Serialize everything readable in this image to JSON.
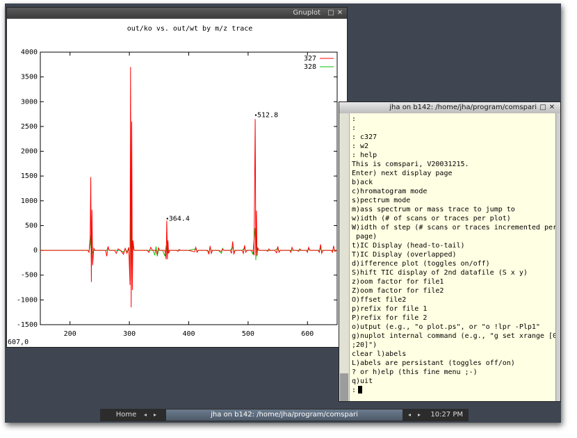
{
  "gnuplot_window": {
    "title": "Gnuplot",
    "status_text": "607,0"
  },
  "terminal_window": {
    "title": "jha on b142: /home/jha/program/comspari",
    "lines": [
      ":",
      ":",
      ": c327",
      ": w2",
      ": help",
      "This is comspari, V20031215.",
      "Enter) next display page",
      "b)ack",
      "c)hromatogram mode",
      "s)pectrum mode",
      "m)ass spectrum or mass trace to jump to",
      "w)idth (# of scans or traces per plot)",
      "W)idth of step (# scans or traces incremented per",
      " page)",
      "t)IC Display (head-to-tail)",
      "T)IC Display (overlapped)",
      "d)ifference plot (toggles on/off)",
      "S)hift TIC display of 2nd datafile (S x y)",
      "z)oom factor for file1",
      "Z)oom factor for file2",
      "O)ffset file2",
      "p)refix for file 1",
      "P)refix for file 2",
      "o)utput (e.g., \"o plot.ps\", or \"o !lpr -Plp1\"",
      "g)nuplot internal command (e.g., \"g set xrange [0",
      ";20]\")",
      "clear l)abels",
      "L)abels are persistant (toggles off/on)",
      "? or h)elp (this fine menu ;-)",
      "q)uit"
    ],
    "prompt": ":"
  },
  "taskbar": {
    "home_label": "Home",
    "task_label": "jha on b142: /home/jha/program/comspari",
    "clock": "10:27 PM"
  },
  "chart_data": {
    "type": "line",
    "title": "out/ko vs. out/wt by m/z trace",
    "xlim": [
      150,
      650
    ],
    "ylim": [
      -1500,
      4000
    ],
    "x_ticks": [
      "200",
      "300",
      "400",
      "500",
      "600"
    ],
    "y_ticks": [
      "-1500",
      "-1000",
      "-500",
      "0",
      "500",
      "1000",
      "1500",
      "2000",
      "2500",
      "3000",
      "3500",
      "4000"
    ],
    "legend_position": "top-right",
    "annotations": [
      {
        "text": "364.4",
        "x": 364,
        "y": 640
      },
      {
        "text": "512.8",
        "x": 513,
        "y": 2730
      }
    ],
    "series": [
      {
        "name": "327",
        "color": "#ff0000",
        "points": [
          [
            150,
            0
          ],
          [
            230,
            0
          ],
          [
            232,
            -40
          ],
          [
            234,
            250
          ],
          [
            235,
            1480
          ],
          [
            236,
            -640
          ],
          [
            237,
            820
          ],
          [
            238,
            -300
          ],
          [
            240,
            40
          ],
          [
            242,
            0
          ],
          [
            260,
            0
          ],
          [
            262,
            -120
          ],
          [
            264,
            80
          ],
          [
            266,
            0
          ],
          [
            275,
            0
          ],
          [
            278,
            -60
          ],
          [
            281,
            30
          ],
          [
            285,
            0
          ],
          [
            290,
            -80
          ],
          [
            293,
            40
          ],
          [
            296,
            -60
          ],
          [
            299,
            60
          ],
          [
            301,
            -700
          ],
          [
            302,
            3700
          ],
          [
            303,
            -1150
          ],
          [
            304,
            2600
          ],
          [
            305,
            -800
          ],
          [
            306,
            200
          ],
          [
            308,
            0
          ],
          [
            330,
            0
          ],
          [
            333,
            -40
          ],
          [
            336,
            60
          ],
          [
            339,
            0
          ],
          [
            345,
            0
          ],
          [
            347,
            -80
          ],
          [
            349,
            50
          ],
          [
            351,
            0
          ],
          [
            360,
            0
          ],
          [
            362,
            -180
          ],
          [
            363,
            600
          ],
          [
            364,
            -180
          ],
          [
            365,
            200
          ],
          [
            366,
            -60
          ],
          [
            368,
            0
          ],
          [
            380,
            0
          ],
          [
            382,
            -20
          ],
          [
            384,
            20
          ],
          [
            386,
            0
          ],
          [
            400,
            0
          ],
          [
            410,
            -30
          ],
          [
            412,
            60
          ],
          [
            414,
            -40
          ],
          [
            416,
            0
          ],
          [
            432,
            0
          ],
          [
            434,
            -80
          ],
          [
            436,
            90
          ],
          [
            438,
            -60
          ],
          [
            440,
            0
          ],
          [
            450,
            0
          ],
          [
            455,
            -20
          ],
          [
            457,
            30
          ],
          [
            459,
            0
          ],
          [
            470,
            0
          ],
          [
            472,
            -60
          ],
          [
            474,
            180
          ],
          [
            476,
            -80
          ],
          [
            478,
            0
          ],
          [
            490,
            0
          ],
          [
            492,
            -60
          ],
          [
            494,
            100
          ],
          [
            496,
            -40
          ],
          [
            498,
            0
          ],
          [
            508,
            0
          ],
          [
            510,
            -100
          ],
          [
            512,
            2650
          ],
          [
            513,
            -100
          ],
          [
            514,
            800
          ],
          [
            515,
            -100
          ],
          [
            516,
            60
          ],
          [
            518,
            0
          ],
          [
            530,
            0
          ],
          [
            533,
            -20
          ],
          [
            535,
            30
          ],
          [
            537,
            0
          ],
          [
            545,
            0
          ],
          [
            548,
            -50
          ],
          [
            550,
            80
          ],
          [
            552,
            -40
          ],
          [
            554,
            0
          ],
          [
            570,
            0
          ],
          [
            572,
            -40
          ],
          [
            574,
            60
          ],
          [
            576,
            0
          ],
          [
            582,
            0
          ],
          [
            585,
            -20
          ],
          [
            587,
            30
          ],
          [
            589,
            0
          ],
          [
            598,
            0
          ],
          [
            600,
            -40
          ],
          [
            602,
            60
          ],
          [
            604,
            0
          ],
          [
            618,
            0
          ],
          [
            620,
            -40
          ],
          [
            622,
            120
          ],
          [
            624,
            -60
          ],
          [
            626,
            0
          ],
          [
            640,
            0
          ],
          [
            642,
            -40
          ],
          [
            644,
            90
          ],
          [
            646,
            -20
          ],
          [
            650,
            0
          ]
        ]
      },
      {
        "name": "328",
        "color": "#00c000",
        "points": [
          [
            150,
            0
          ],
          [
            230,
            0
          ],
          [
            232,
            -30
          ],
          [
            234,
            120
          ],
          [
            235,
            300
          ],
          [
            236,
            -200
          ],
          [
            237,
            150
          ],
          [
            238,
            -60
          ],
          [
            240,
            0
          ],
          [
            262,
            0
          ],
          [
            264,
            60
          ],
          [
            266,
            0
          ],
          [
            285,
            0
          ],
          [
            290,
            -40
          ],
          [
            293,
            30
          ],
          [
            296,
            -30
          ],
          [
            299,
            40
          ],
          [
            301,
            -400
          ],
          [
            302,
            1300
          ],
          [
            303,
            -600
          ],
          [
            304,
            900
          ],
          [
            305,
            -400
          ],
          [
            306,
            100
          ],
          [
            308,
            0
          ],
          [
            340,
            0
          ],
          [
            343,
            -100
          ],
          [
            345,
            80
          ],
          [
            347,
            -120
          ],
          [
            349,
            0
          ],
          [
            356,
            0
          ],
          [
            360,
            -120
          ],
          [
            362,
            100
          ],
          [
            364,
            -80
          ],
          [
            366,
            0
          ],
          [
            400,
            0
          ],
          [
            412,
            30
          ],
          [
            414,
            -20
          ],
          [
            416,
            0
          ],
          [
            430,
            0
          ],
          [
            434,
            -40
          ],
          [
            436,
            50
          ],
          [
            438,
            0
          ],
          [
            450,
            0
          ],
          [
            455,
            -60
          ],
          [
            457,
            40
          ],
          [
            459,
            0
          ],
          [
            470,
            0
          ],
          [
            474,
            60
          ],
          [
            476,
            -30
          ],
          [
            478,
            0
          ],
          [
            490,
            0
          ],
          [
            494,
            50
          ],
          [
            496,
            -20
          ],
          [
            498,
            0
          ],
          [
            505,
            0
          ],
          [
            508,
            -80
          ],
          [
            510,
            200
          ],
          [
            512,
            450
          ],
          [
            513,
            -200
          ],
          [
            514,
            400
          ],
          [
            515,
            -120
          ],
          [
            516,
            40
          ],
          [
            518,
            0
          ],
          [
            545,
            0
          ],
          [
            550,
            40
          ],
          [
            552,
            -20
          ],
          [
            554,
            0
          ],
          [
            600,
            0
          ],
          [
            602,
            30
          ],
          [
            604,
            0
          ],
          [
            620,
            0
          ],
          [
            622,
            40
          ],
          [
            624,
            -20
          ],
          [
            626,
            0
          ],
          [
            650,
            0
          ]
        ]
      }
    ]
  }
}
